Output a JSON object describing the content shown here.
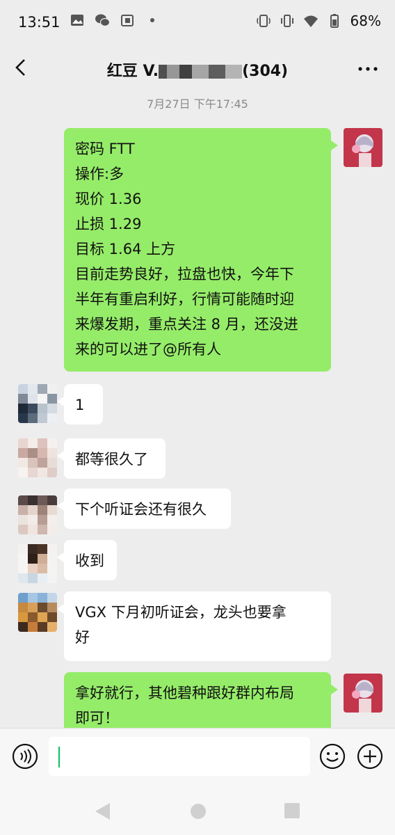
{
  "status": {
    "time": "13:51",
    "battery": "68%",
    "left_icons": [
      "gallery-icon",
      "wechat-icon",
      "notification-icon",
      "dot-icon"
    ],
    "right_icons": [
      "nfc-icon",
      "vibrate-icon",
      "wifi-icon",
      "battery-icon"
    ]
  },
  "nav": {
    "title_left": "红豆 V.",
    "title_right": "(304)"
  },
  "chat": {
    "timestamp": "7月27日 下午17:45",
    "messages": [
      {
        "side": "out",
        "lines": [
          "密码 FTT",
          "操作:多",
          "现价 1.36",
          "止损 1.29",
          "目标 1.64 上方",
          "目前走势良好，拉盘也快，今年下",
          "半年有重启利好，行情可能随时迎",
          "来爆发期，重点关注 8 月，还没进",
          "来的可以进了@所有人"
        ]
      },
      {
        "side": "in",
        "lines": [
          "1"
        ]
      },
      {
        "side": "in",
        "lines": [
          "都等很久了"
        ]
      },
      {
        "side": "in",
        "lines": [
          "下个听证会还有很久"
        ]
      },
      {
        "side": "in",
        "lines": [
          "收到"
        ]
      },
      {
        "side": "in",
        "lines": [
          "VGX 下月初听证会，龙头也要拿",
          "好"
        ]
      },
      {
        "side": "out",
        "lines": [
          "拿好就行，其他碧种跟好群内布局",
          "即可！"
        ]
      }
    ]
  },
  "input": {
    "placeholder": "",
    "icons": [
      "voice-icon",
      "emoji-icon",
      "plus-icon"
    ]
  },
  "colors": {
    "outgoing_bubble": "#95ec69",
    "incoming_bubble": "#ffffff",
    "background": "#ededed",
    "caret": "#07c160",
    "self_avatar": "#c2354a"
  }
}
